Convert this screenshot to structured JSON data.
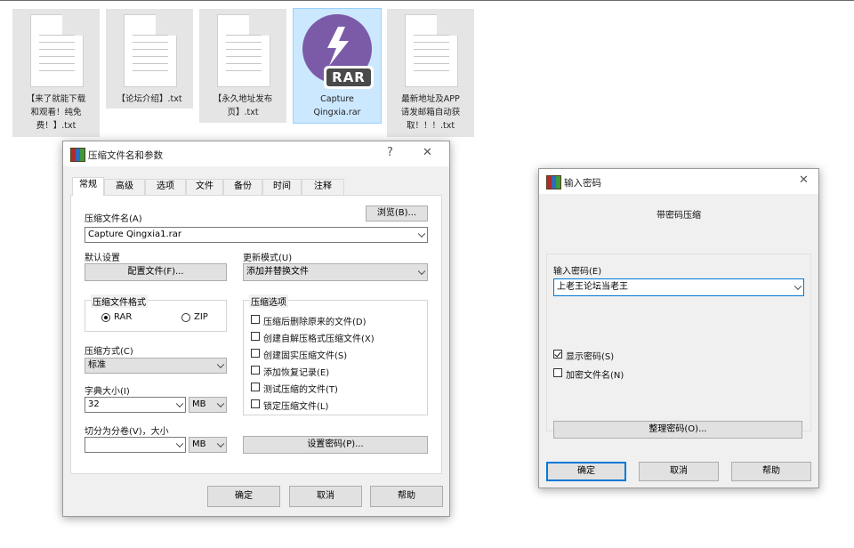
{
  "files": [
    {
      "label_lines": [
        "【来了就能下载",
        "和观看！纯免",
        "费！】.txt"
      ]
    },
    {
      "label_lines": [
        "【论坛介绍】.txt"
      ]
    },
    {
      "label_lines": [
        "【永久地址发布",
        "页】.txt"
      ]
    },
    {
      "label_lines": [
        "Capture",
        "Qingxia.rar"
      ],
      "badge": "RAR",
      "selected": true
    },
    {
      "label_lines": [
        "最新地址及APP",
        "请发邮箱自动获",
        "取！！！.txt"
      ]
    }
  ],
  "archive_dialog": {
    "title": "压缩文件名和参数",
    "help_glyph": "?",
    "close_glyph": "✕",
    "tabs": [
      "常规",
      "高级",
      "选项",
      "文件",
      "备份",
      "时间",
      "注释"
    ],
    "archive_name_label": "压缩文件名(A)",
    "browse_label": "浏览(B)...",
    "archive_name_value": "Capture Qingxia1.rar",
    "default_settings_label": "默认设置",
    "profiles_label": "配置文件(F)...",
    "update_mode_label": "更新模式(U)",
    "update_mode_value": "添加并替换文件",
    "format_group_title": "压缩文件格式",
    "format_rar": "RAR",
    "format_zip": "ZIP",
    "options_group_title": "压缩选项",
    "options": [
      {
        "label": "压缩后删除原来的文件(D)",
        "checked": false
      },
      {
        "label": "创建自解压格式压缩文件(X)",
        "checked": false
      },
      {
        "label": "创建固实压缩文件(S)",
        "checked": false
      },
      {
        "label": "添加恢复记录(E)",
        "checked": false
      },
      {
        "label": "测试压缩的文件(T)",
        "checked": false
      },
      {
        "label": "锁定压缩文件(L)",
        "checked": false
      }
    ],
    "method_label": "压缩方式(C)",
    "method_value": "标准",
    "dict_label": "字典大小(I)",
    "dict_value": "32",
    "dict_unit": "MB",
    "split_label": "切分为分卷(V)，大小",
    "split_value": "",
    "split_unit": "MB",
    "set_password_label": "设置密码(P)...",
    "ok_label": "确定",
    "cancel_label": "取消",
    "help_label": "帮助"
  },
  "password_dialog": {
    "title": "输入密码",
    "close_glyph": "✕",
    "heading": "带密码压缩",
    "enter_password_label": "输入密码(E)",
    "password_value": "上老王论坛当老王",
    "show_password_label": "显示密码(S)",
    "show_password_checked": true,
    "encrypt_names_label": "加密文件名(N)",
    "encrypt_names_checked": false,
    "organize_label": "整理密码(O)...",
    "ok_label": "确定",
    "cancel_label": "取消",
    "help_label": "帮助"
  }
}
